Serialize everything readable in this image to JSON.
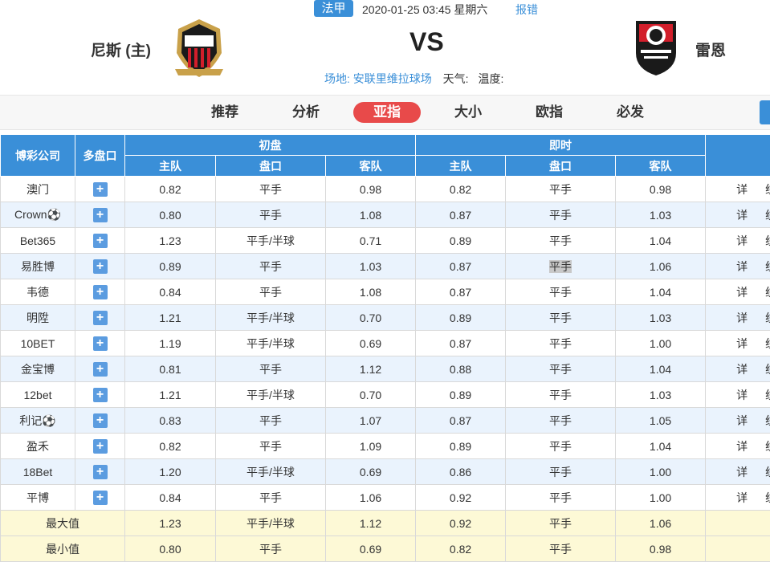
{
  "match": {
    "league": "法甲",
    "datetime": "2020-01-25 03:45 星期六",
    "report": "报错",
    "home": "尼斯 (主)",
    "away": "雷恩",
    "vs": "VS",
    "venue_label": "场地:",
    "venue": "安联里维拉球场",
    "weather_label": "天气:",
    "temp_label": "温度:"
  },
  "tabs": [
    "推荐",
    "分析",
    "亚指",
    "大小",
    "欧指",
    "必发"
  ],
  "active_tab": "亚指",
  "table": {
    "headers": {
      "company": "博彩公司",
      "multi": "多盘口",
      "initial": "初盘",
      "live": "即时",
      "home": "主队",
      "line": "盘口",
      "away": "客队"
    },
    "plus_icon": "plus-icon",
    "detail_label": "详",
    "trend_label": "统",
    "rows": [
      {
        "company": "澳门",
        "ih": "0.82",
        "il": "平手",
        "ia": "0.98",
        "lh": "0.82",
        "ll": "平手",
        "la": "0.98"
      },
      {
        "company": "Crown⚽",
        "ih": "0.80",
        "il": "平手",
        "ia": "1.08",
        "lh": "0.87",
        "ll": "平手",
        "la": "1.03"
      },
      {
        "company": "Bet365",
        "ih": "1.23",
        "il": "平手/半球",
        "ia": "0.71",
        "lh": "0.89",
        "ll": "平手",
        "la": "1.04"
      },
      {
        "company": "易胜博",
        "ih": "0.89",
        "il": "平手",
        "ia": "1.03",
        "lh": "0.87",
        "ll": "平手",
        "la": "1.06"
      },
      {
        "company": "韦德",
        "ih": "0.84",
        "il": "平手",
        "ia": "1.08",
        "lh": "0.87",
        "ll": "平手",
        "la": "1.04"
      },
      {
        "company": "明陞",
        "ih": "1.21",
        "il": "平手/半球",
        "ia": "0.70",
        "lh": "0.89",
        "ll": "平手",
        "la": "1.03"
      },
      {
        "company": "10BET",
        "ih": "1.19",
        "il": "平手/半球",
        "ia": "0.69",
        "lh": "0.87",
        "ll": "平手",
        "la": "1.00"
      },
      {
        "company": "金宝博",
        "ih": "0.81",
        "il": "平手",
        "ia": "1.12",
        "lh": "0.88",
        "ll": "平手",
        "la": "1.04"
      },
      {
        "company": "12bet",
        "ih": "1.21",
        "il": "平手/半球",
        "ia": "0.70",
        "lh": "0.89",
        "ll": "平手",
        "la": "1.03"
      },
      {
        "company": "利记⚽",
        "ih": "0.83",
        "il": "平手",
        "ia": "1.07",
        "lh": "0.87",
        "ll": "平手",
        "la": "1.05"
      },
      {
        "company": "盈禾",
        "ih": "0.82",
        "il": "平手",
        "ia": "1.09",
        "lh": "0.89",
        "ll": "平手",
        "la": "1.04"
      },
      {
        "company": "18Bet",
        "ih": "1.20",
        "il": "平手/半球",
        "ia": "0.69",
        "lh": "0.86",
        "ll": "平手",
        "la": "1.00"
      },
      {
        "company": "平博",
        "ih": "0.84",
        "il": "平手",
        "ia": "1.06",
        "lh": "0.92",
        "ll": "平手",
        "la": "1.00"
      }
    ],
    "summary": [
      {
        "label": "最大值",
        "ih": "1.23",
        "il": "平手/半球",
        "ia": "1.12",
        "lh": "0.92",
        "ll": "平手",
        "la": "1.06"
      },
      {
        "label": "最小值",
        "ih": "0.80",
        "il": "平手",
        "ia": "0.69",
        "lh": "0.82",
        "ll": "平手",
        "la": "0.98"
      }
    ]
  },
  "colors": {
    "accent": "#3a8fd8",
    "active_tab": "#e84a4a",
    "row_alt": "#eaf3fd",
    "summary": "#fdf9d6"
  }
}
